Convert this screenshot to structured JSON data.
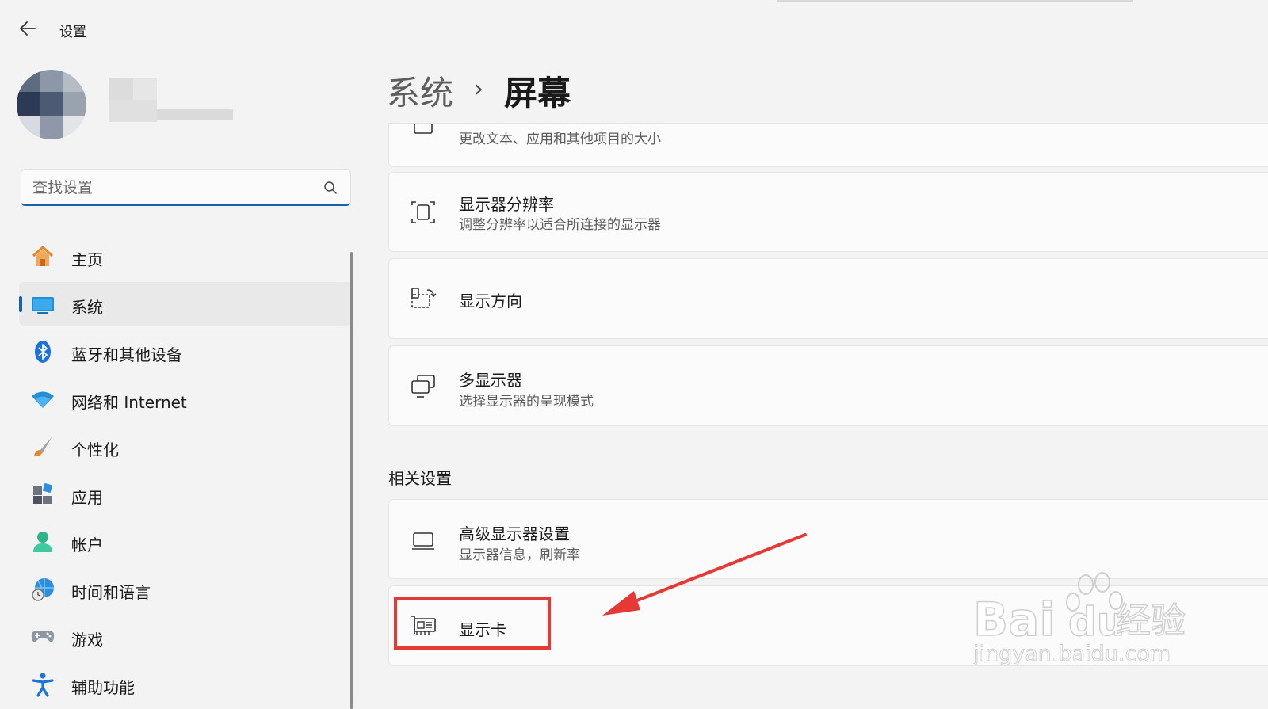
{
  "app": {
    "title": "设置"
  },
  "search": {
    "placeholder": "查找设置"
  },
  "sidebar": {
    "items": [
      {
        "label": "主页",
        "icon": "home-icon"
      },
      {
        "label": "系统",
        "icon": "system-display-icon",
        "active": true
      },
      {
        "label": "蓝牙和其他设备",
        "icon": "bluetooth-icon"
      },
      {
        "label": "网络和 Internet",
        "icon": "wifi-icon"
      },
      {
        "label": "个性化",
        "icon": "brush-icon"
      },
      {
        "label": "应用",
        "icon": "apps-icon"
      },
      {
        "label": "帐户",
        "icon": "account-icon"
      },
      {
        "label": "时间和语言",
        "icon": "globe-clock-icon"
      },
      {
        "label": "游戏",
        "icon": "gamepad-icon"
      },
      {
        "label": "辅助功能",
        "icon": "accessibility-icon"
      }
    ]
  },
  "breadcrumb": {
    "parent": "系统",
    "separator": "›",
    "current": "屏幕"
  },
  "cards": [
    {
      "title": "",
      "subtitle": "更改文本、应用和其他项目的大小",
      "icon": "scale-icon"
    },
    {
      "title": "显示器分辨率",
      "subtitle": "调整分辨率以适合所连接的显示器",
      "icon": "resolution-icon"
    },
    {
      "title": "显示方向",
      "subtitle": "",
      "icon": "orientation-icon"
    },
    {
      "title": "多显示器",
      "subtitle": "选择显示器的呈现模式",
      "icon": "multiple-displays-icon"
    }
  ],
  "related": {
    "title": "相关设置",
    "cards": [
      {
        "title": "高级显示器设置",
        "subtitle": "显示器信息，刷新率",
        "icon": "monitor-icon"
      },
      {
        "title": "显示卡",
        "subtitle": "",
        "icon": "graphics-card-icon"
      }
    ]
  },
  "watermark": {
    "brand": "Bai",
    "brand_du": "du",
    "brand_cn": "经验",
    "url": "jingyan.baidu.com"
  },
  "colors": {
    "accent": "#1b5fa8",
    "annotation": "#e53935",
    "background": "#f3f3f3"
  }
}
